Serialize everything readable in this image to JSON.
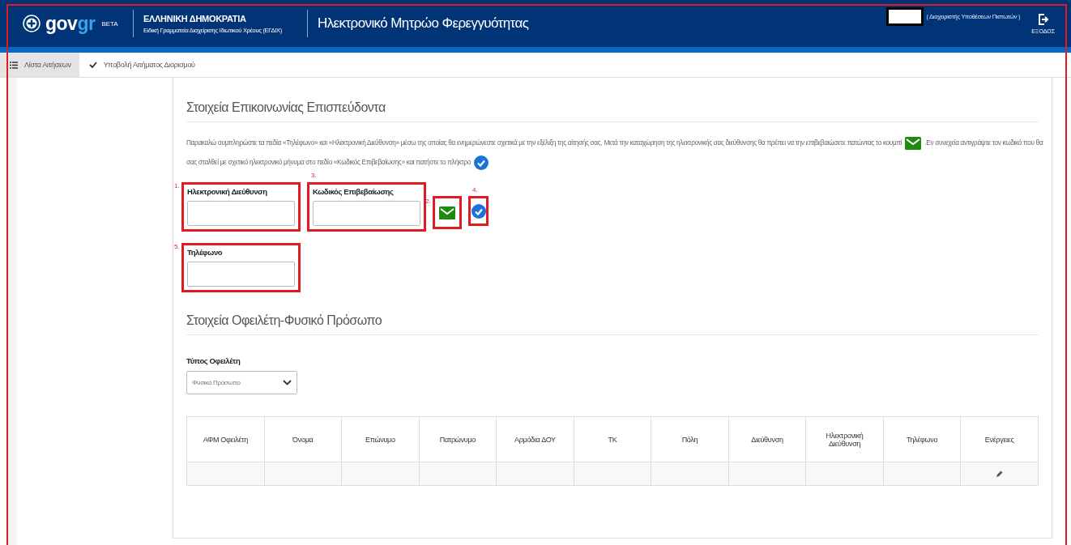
{
  "header": {
    "logo_text": "gov",
    "logo_text_accent": "gr",
    "logo_badge": "BETA",
    "org_title": "ΕΛΛΗΝΙΚΗ ΔΗΜΟΚΡΑΤΙΑ",
    "org_subtitle": "Ειδική Γραμματεία Διαχείρισης Ιδιωτικού Χρέους (ΕΓΔΙΧ)",
    "app_title": "Ηλεκτρονικό Μητρώο Φερεγγυότητας",
    "user_role": "( Διαχειριστής Υποθέσεων Πιστωτών )",
    "logout_label": "ΕΞΟΔΟΣ"
  },
  "nav_tabs": [
    {
      "label": "Λίστα Αιτήσεων",
      "kind": "list",
      "selected": true
    },
    {
      "label": "Υποβολή Αιτήματος Διορισμού",
      "kind": "check",
      "selected": false
    }
  ],
  "contact_section": {
    "title": "Στοιχεία Επικοινωνίας Επισπεύδοντα",
    "instructions_part_1": "Παρακαλώ συμπληρώστε τα πεδία «Τηλέφωνο» και «Ηλεκτρονική Διεύθυνση» μέσω της οποίας θα ενημερώνεστε σχετικά με την εξέλιξη της αίτησής σας. Μετά την καταχώρηση της ηλεκτρονικής σας διεύθυνσης θα πρέπει να την επιβεβαιώσετε πατώντας το κουμπί",
    "instructions_part_2": ".Εν συνεχεία αντιγράψτε τον κωδικό που θα",
    "instructions_part_3": "σας σταλθεί με σχετικό ηλεκτρονικό μήνυμα στο πεδίο «Κωδικός Επιβεβαίωσης» και πατήστε το πλήκτρο",
    "email_field": {
      "label": "Ηλεκτρονική Διεύθυνση",
      "annotation": "1."
    },
    "code_field": {
      "label": "Κωδικός Επιβεβαίωσης",
      "annotation": "3."
    },
    "send_code_button": {
      "annotation": "2."
    },
    "verify_button": {
      "annotation": "4."
    },
    "phone_field": {
      "label": "Τηλέφωνο",
      "annotation": "5."
    }
  },
  "debtor_section": {
    "title": "Στοιχεία Οφειλέτη-Φυσικό Πρόσωπο",
    "debtor_type": {
      "label": "Τύπος Οφειλέτη",
      "value": "Φυσικό Πρόσωπο"
    },
    "table": {
      "columns": [
        "ΑΦΜ Οφειλέτη",
        "Όνομα",
        "Επώνυμο",
        "Πατρώνυμο",
        "Αρμόδια ΔΟΥ",
        "ΤΚ",
        "Πόλη",
        "Διεύθυνση",
        "Ηλεκτρονική Διεύθυνση",
        "Τηλέφωνο",
        "Ενέργειες"
      ],
      "rows": [
        {
          "editable": true
        }
      ]
    }
  }
}
